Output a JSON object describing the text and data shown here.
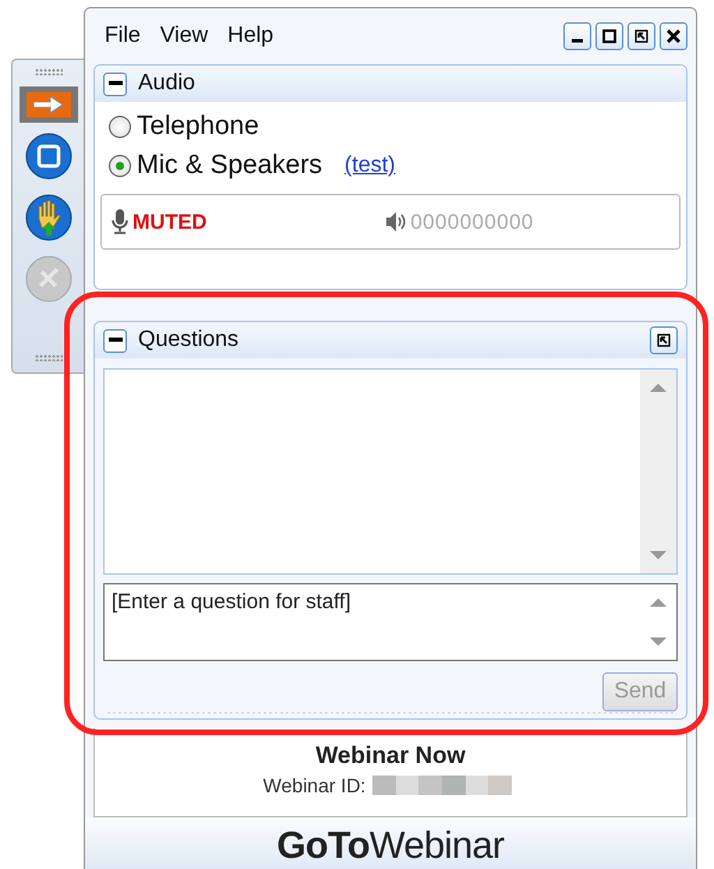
{
  "menu": [
    "File",
    "View",
    "Help"
  ],
  "side_tools": [
    {
      "kind": "arrow",
      "selected": true,
      "disabled": false
    },
    {
      "kind": "screen",
      "selected": false,
      "disabled": false
    },
    {
      "kind": "hand",
      "selected": false,
      "disabled": false
    },
    {
      "kind": "hand-off",
      "selected": false,
      "disabled": true
    }
  ],
  "audio": {
    "title": "Audio",
    "options": [
      {
        "label": "Telephone",
        "selected": false
      },
      {
        "label": "Mic & Speakers",
        "selected": true,
        "link": "(test)"
      }
    ],
    "mic_status": "MUTED",
    "speaker_meter": "0000000000"
  },
  "questions": {
    "title": "Questions",
    "placeholder": "[Enter a question for staff]",
    "send": {
      "label": "Send",
      "disabled": true
    }
  },
  "webinar": {
    "title": "Webinar Now",
    "id_label": "Webinar ID:"
  },
  "logo": "**GoTo**Webinar"
}
